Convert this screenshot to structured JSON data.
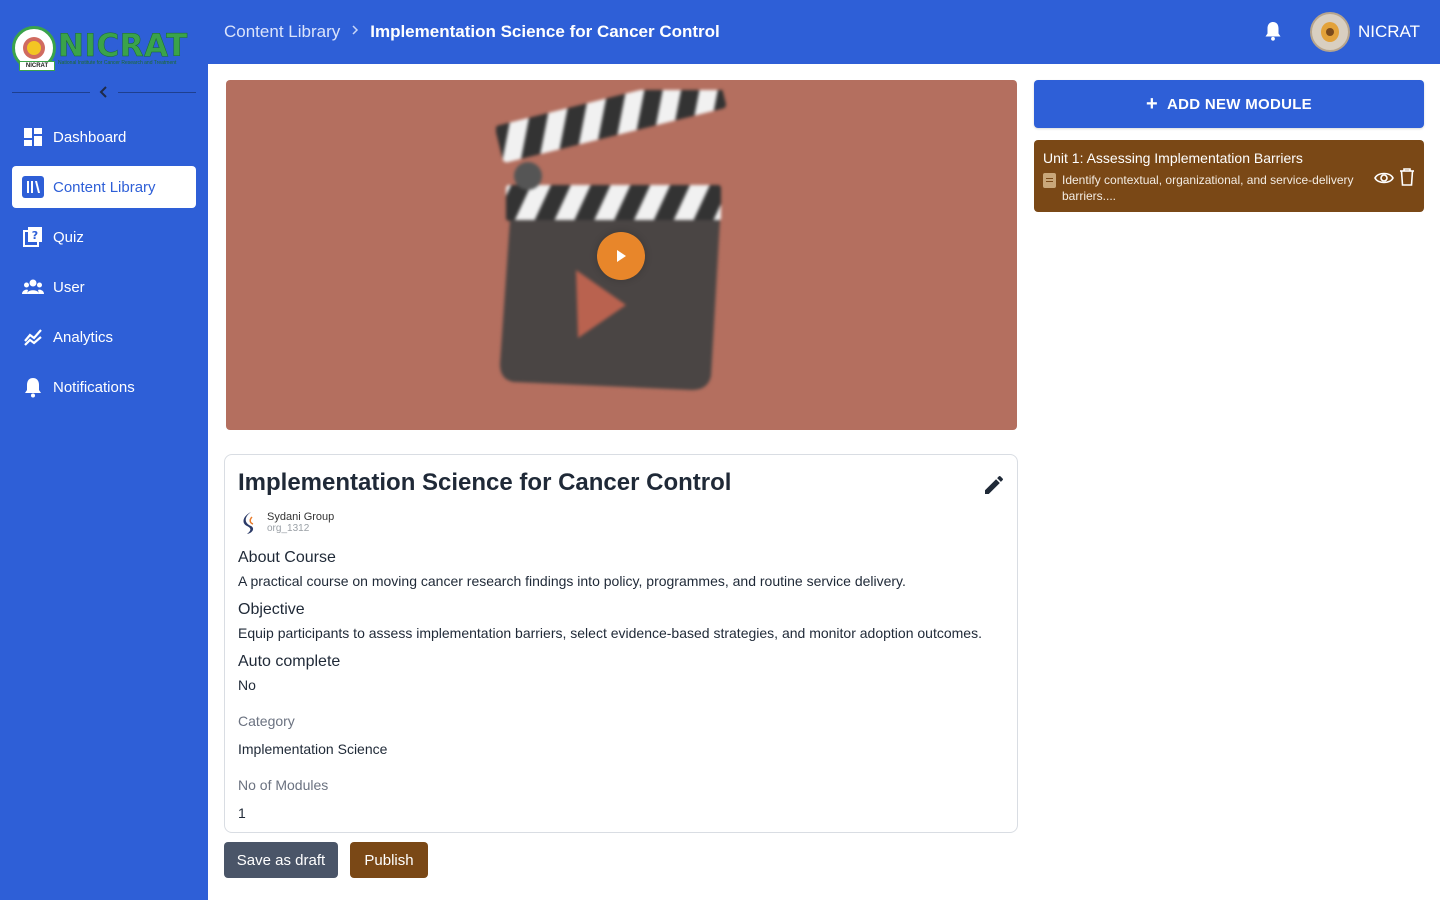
{
  "brand": {
    "logo_text": "NICRAT",
    "logo_subtitle": "National Institute for Cancer Research and Treatment",
    "seal_tag": "NICRAT",
    "primary_color": "#2e5fd7",
    "accent_brown": "#7a4816"
  },
  "sidebar": {
    "collapse_icon": "chevron-left-icon",
    "items": [
      {
        "label": "Dashboard",
        "icon": "dashboard-icon",
        "active": false
      },
      {
        "label": "Content Library",
        "icon": "library-icon",
        "active": true
      },
      {
        "label": "Quiz",
        "icon": "quiz-icon",
        "active": false
      },
      {
        "label": "User",
        "icon": "users-icon",
        "active": false
      },
      {
        "label": "Analytics",
        "icon": "analytics-icon",
        "active": false
      },
      {
        "label": "Notifications",
        "icon": "bell-icon",
        "active": false
      }
    ]
  },
  "header": {
    "breadcrumb_root": "Content Library",
    "breadcrumb_current": "Implementation Science for Cancer Control",
    "username": "NICRAT"
  },
  "course": {
    "title": "Implementation Science for Cancer Control",
    "org_name": "Sydani Group",
    "org_id": "org_1312",
    "about_heading": "About Course",
    "about_text": "A practical course on moving cancer research findings into policy, programmes, and routine service delivery.",
    "objective_heading": "Objective",
    "objective_text": "Equip participants to assess implementation barriers, select evidence-based strategies, and monitor adoption outcomes.",
    "autocomplete_heading": "Auto complete",
    "autocomplete_value": "No",
    "category_label": "Category",
    "category_value": "Implementation Science",
    "modules_label": "No of Modules",
    "modules_value": "1"
  },
  "actions": {
    "draft_label": "Save as draft",
    "publish_label": "Publish"
  },
  "modules_panel": {
    "add_label": "ADD NEW MODULE",
    "modules": [
      {
        "title": "Unit 1: Assessing Implementation Barriers",
        "description": "Identify contextual, organizational, and service-delivery barriers...."
      }
    ]
  }
}
